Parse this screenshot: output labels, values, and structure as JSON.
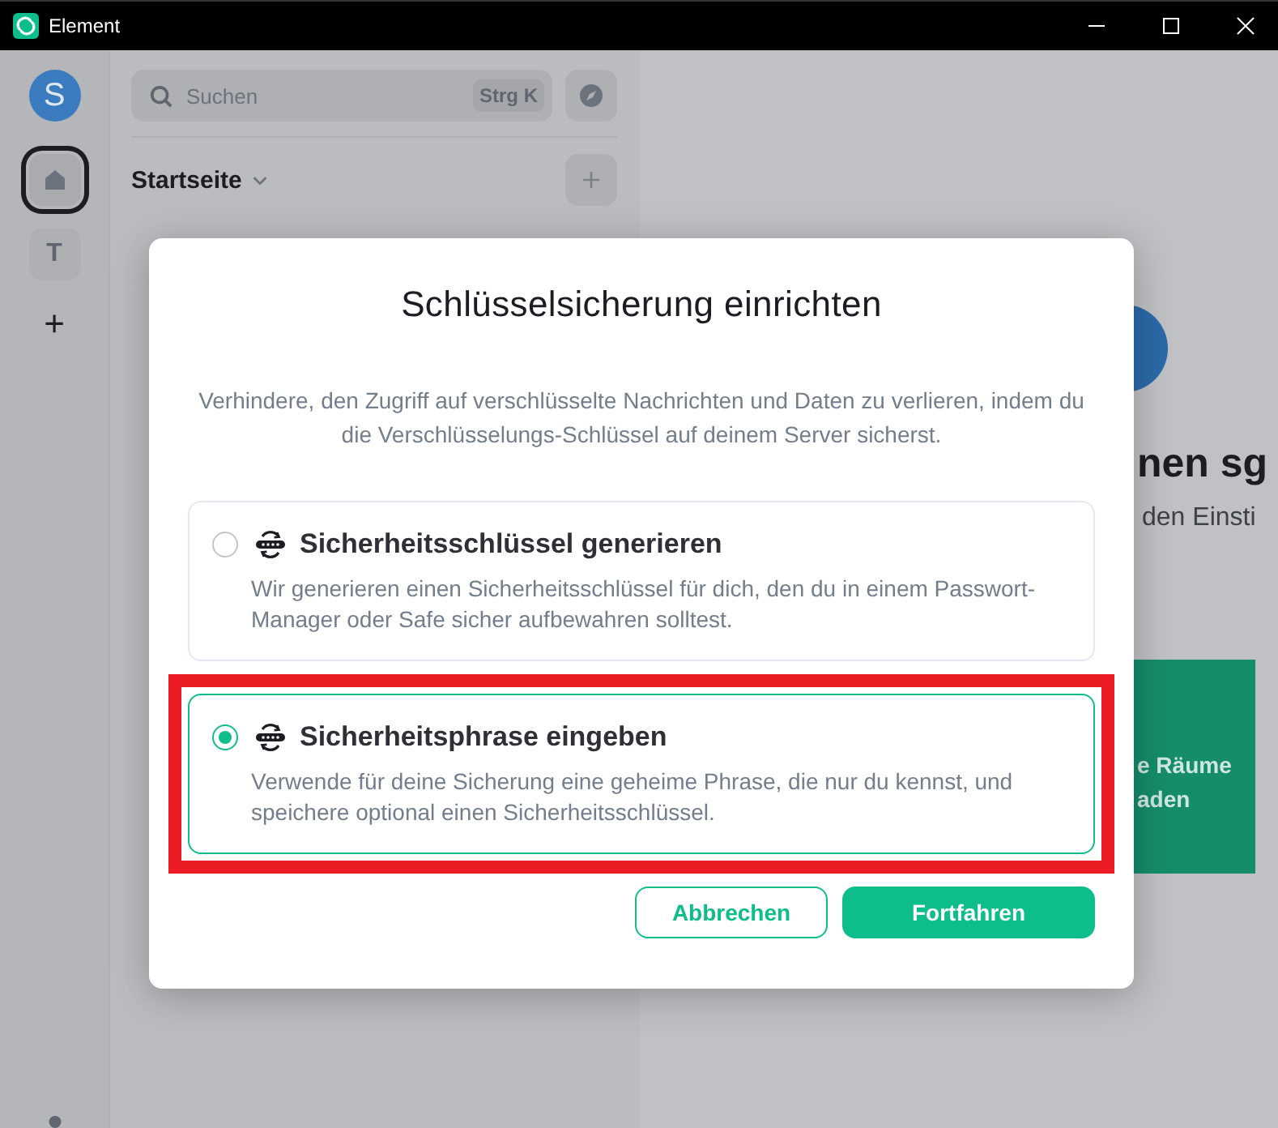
{
  "window": {
    "title": "Element"
  },
  "spaces": [
    {
      "kind": "avatar",
      "label": "S"
    },
    {
      "kind": "home",
      "selected": true
    },
    {
      "kind": "letter",
      "label": "T",
      "selected": false
    },
    {
      "kind": "add",
      "label": "+"
    }
  ],
  "search": {
    "placeholder": "Suchen",
    "shortcut": "Strg K"
  },
  "room_list": {
    "title": "Startseite"
  },
  "main": {
    "heading": "nen sg",
    "subheading": "den Einsti",
    "card_lines": [
      "e Räume",
      "aden"
    ]
  },
  "dialog": {
    "title": "Schlüsselsicherung einrichten",
    "description": "Verhindere, den Zugriff auf verschlüsselte Nachrichten und Daten zu verlieren, indem du die Verschlüsselungs-Schlüssel auf deinem Server sicherst.",
    "options": [
      {
        "title": "Sicherheitsschlüssel generieren",
        "description": "Wir generieren einen Sicherheitsschlüssel für dich, den du in einem Passwort-Manager oder Safe sicher aufbewahren solltest.",
        "selected": false,
        "highlighted": false
      },
      {
        "title": "Sicherheitsphrase eingeben",
        "description": "Verwende für deine Sicherung eine geheime Phrase, die nur du kennst, und speichere optional einen Sicherheitsschlüssel.",
        "selected": true,
        "highlighted": true
      }
    ],
    "buttons": [
      {
        "label": "Abbrechen",
        "kind": "secondary"
      },
      {
        "label": "Fortfahren",
        "kind": "primary"
      }
    ]
  }
}
